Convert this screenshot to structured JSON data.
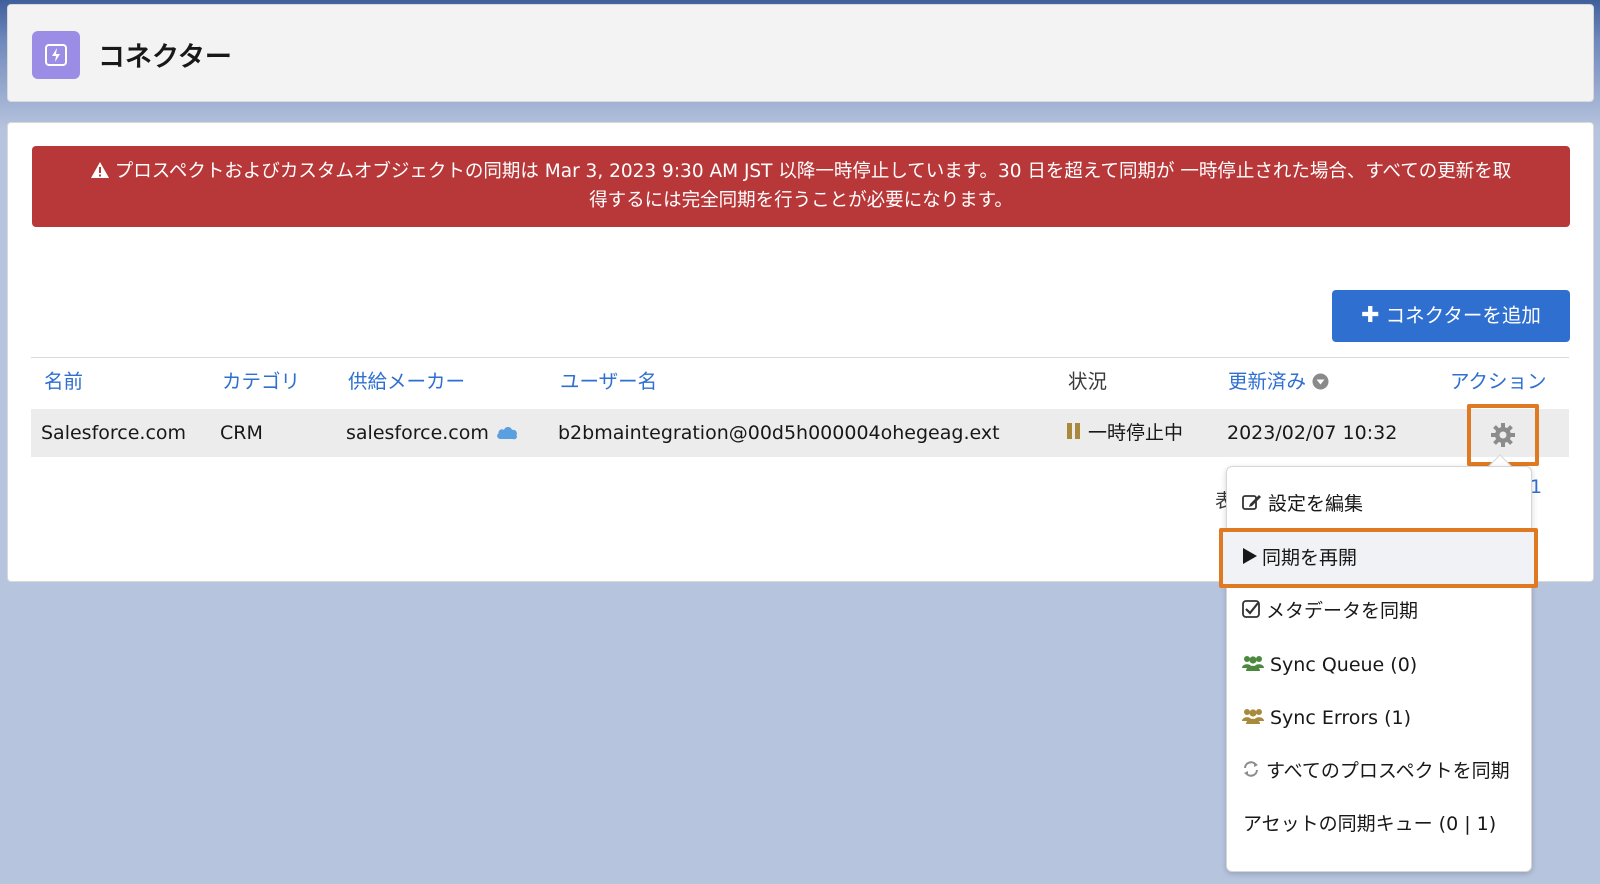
{
  "header": {
    "title": "コネクター"
  },
  "alert": {
    "line1": "プロスペクトおよびカスタムオブジェクトの同期は Mar 3, 2023 9:30 AM JST 以降一時停止しています。30 日を超えて同期が 一時停止された場合、すべての更新を取",
    "line2": "得するには完全同期を行うことが必要になります。",
    "color": "#b8383a"
  },
  "toolbar": {
    "add_connector_label": "コネクターを追加",
    "accent": "#2e6fd0"
  },
  "table": {
    "columns": {
      "name": "名前",
      "category": "カテゴリ",
      "vendor": "供給メーカー",
      "username": "ユーザー名",
      "status": "状況",
      "updated": "更新済み",
      "actions": "アクション"
    },
    "rows": [
      {
        "name": "Salesforce.com",
        "category": "CRM",
        "vendor": "salesforce.com",
        "username": "b2bmaintegration@00d5h000004ohegeag.ext",
        "status": "一時停止中",
        "updated": "2023/02/07 10:32"
      }
    ]
  },
  "pager": {
    "left_partial": "表",
    "right_partial": "1"
  },
  "action_menu": {
    "items": [
      {
        "label": "設定を編集",
        "icon": "edit-icon"
      },
      {
        "label": "同期を再開",
        "icon": "play-icon"
      },
      {
        "label": "メタデータを同期",
        "icon": "checkbox-icon"
      },
      {
        "label": "Sync Queue (0)",
        "icon": "users-icon"
      },
      {
        "label": "Sync Errors (1)",
        "icon": "users-icon"
      },
      {
        "label": "すべてのプロスペクトを同期",
        "icon": "refresh-icon"
      },
      {
        "label": "アセットの同期キュー (0 | 1)",
        "icon": ""
      }
    ],
    "highlight_color": "#e07a22"
  }
}
